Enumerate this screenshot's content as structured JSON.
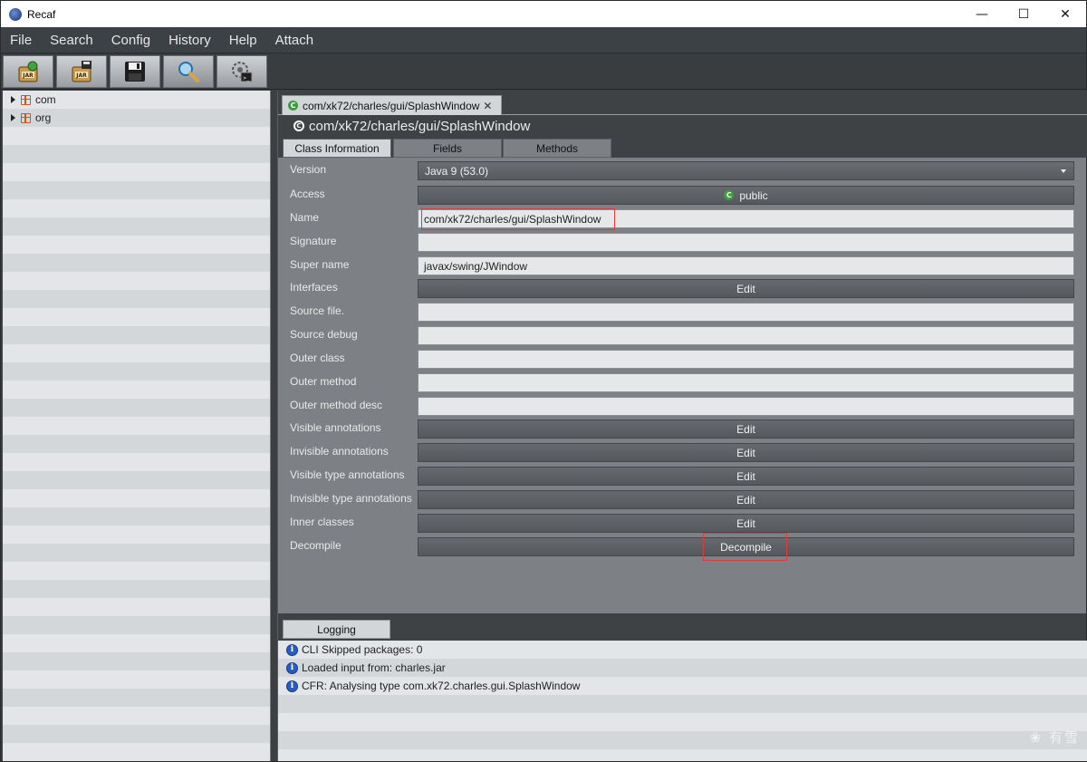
{
  "window": {
    "title": "Recaf",
    "minimize": "—",
    "maximize": "☐",
    "close": "✕"
  },
  "menu": [
    "File",
    "Search",
    "Config",
    "History",
    "Help",
    "Attach"
  ],
  "toolbar": [
    "jar-load-icon",
    "jar-export-icon",
    "save-icon",
    "search-icon",
    "settings-icon"
  ],
  "tree": {
    "items": [
      {
        "label": "com"
      },
      {
        "label": "org"
      }
    ]
  },
  "editor": {
    "tab_label": "com/xk72/charles/gui/SplashWindow",
    "tab_close": "✕",
    "class_title": "com/xk72/charles/gui/SplashWindow",
    "subtabs": [
      "Class Information",
      "Fields",
      "Methods"
    ],
    "fields": {
      "version": {
        "label": "Version",
        "value": "Java 9 (53.0)"
      },
      "access": {
        "label": "Access",
        "value": "public"
      },
      "name": {
        "label": "Name",
        "value": "com/xk72/charles/gui/SplashWindow"
      },
      "signature": {
        "label": "Signature",
        "value": ""
      },
      "super_name": {
        "label": "Super name",
        "value": "javax/swing/JWindow"
      },
      "interfaces": {
        "label": "Interfaces",
        "button": "Edit"
      },
      "source_file": {
        "label": "Source file.",
        "value": ""
      },
      "source_debug": {
        "label": "Source debug",
        "value": ""
      },
      "outer_class": {
        "label": "Outer class",
        "value": ""
      },
      "outer_method": {
        "label": "Outer method",
        "value": ""
      },
      "outer_method_desc": {
        "label": "Outer method desc",
        "value": ""
      },
      "visible_annotations": {
        "label": "Visible annotations",
        "button": "Edit"
      },
      "invisible_annotations": {
        "label": "Invisible annotations",
        "button": "Edit"
      },
      "visible_type_annotations": {
        "label": "Visible type annotations",
        "button": "Edit"
      },
      "invisible_type_annotations": {
        "label": "Invisible type annotations",
        "button": "Edit"
      },
      "inner_classes": {
        "label": "Inner classes",
        "button": "Edit"
      },
      "decompile": {
        "label": "Decompile",
        "button": "Decompile"
      }
    }
  },
  "logging": {
    "tab": "Logging",
    "entries": [
      "CLI Skipped packages: 0",
      "Loaded input from: charles.jar",
      "CFR: Analysing type com.xk72.charles.gui.SplashWindow"
    ]
  },
  "watermark": "❀ 有雪",
  "colors": {
    "highlight": "#e03a3a",
    "class_icon": "#3b9d3e",
    "info_icon": "#2a5cc0"
  }
}
